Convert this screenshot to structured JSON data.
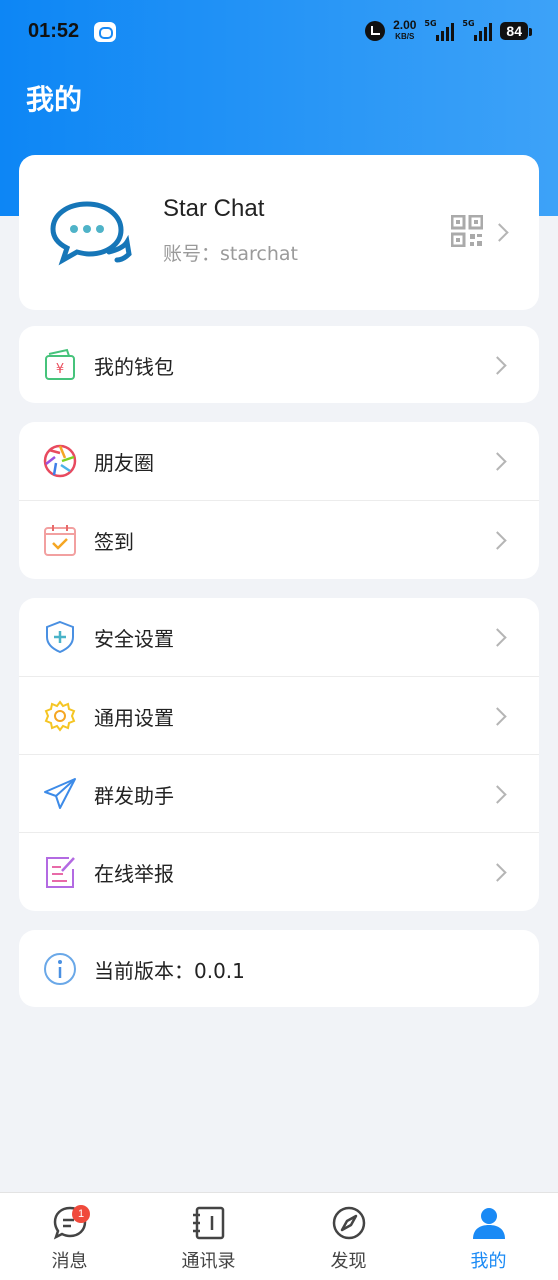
{
  "status_bar": {
    "time": "01:52",
    "net_speed": "2.00",
    "net_speed_unit": "KB/S",
    "signal_1_tag": "5G",
    "signal_2_tag": "5G",
    "battery": "84"
  },
  "page_title": "我的",
  "profile": {
    "name": "Star Chat",
    "account": "账号：starchat",
    "avatar_icon": "chat-bubbles-icon",
    "qr_icon": "qr-code-icon"
  },
  "wallet": {
    "label": "我的钱包",
    "icon": "wallet-icon"
  },
  "social": [
    {
      "label": "朋友圈",
      "icon": "aperture-icon"
    },
    {
      "label": "签到",
      "icon": "calendar-check-icon"
    }
  ],
  "settings": [
    {
      "label": "安全设置",
      "icon": "shield-icon"
    },
    {
      "label": "通用设置",
      "icon": "gear-icon"
    },
    {
      "label": "群发助手",
      "icon": "paper-plane-icon"
    },
    {
      "label": "在线举报",
      "icon": "edit-report-icon"
    }
  ],
  "version": {
    "label": "当前版本：0.0.1",
    "icon": "info-icon"
  },
  "tabs": [
    {
      "label": "消息",
      "icon": "message-icon",
      "badge": "1"
    },
    {
      "label": "通讯录",
      "icon": "contacts-icon"
    },
    {
      "label": "发现",
      "icon": "compass-icon"
    },
    {
      "label": "我的",
      "icon": "user-icon",
      "active": true
    }
  ],
  "colors": {
    "accent": "#1a8af5",
    "header_start": "#0d86f5",
    "header_end": "#3da2f8",
    "background": "#f1f3f7",
    "badge": "#f04a3c"
  }
}
